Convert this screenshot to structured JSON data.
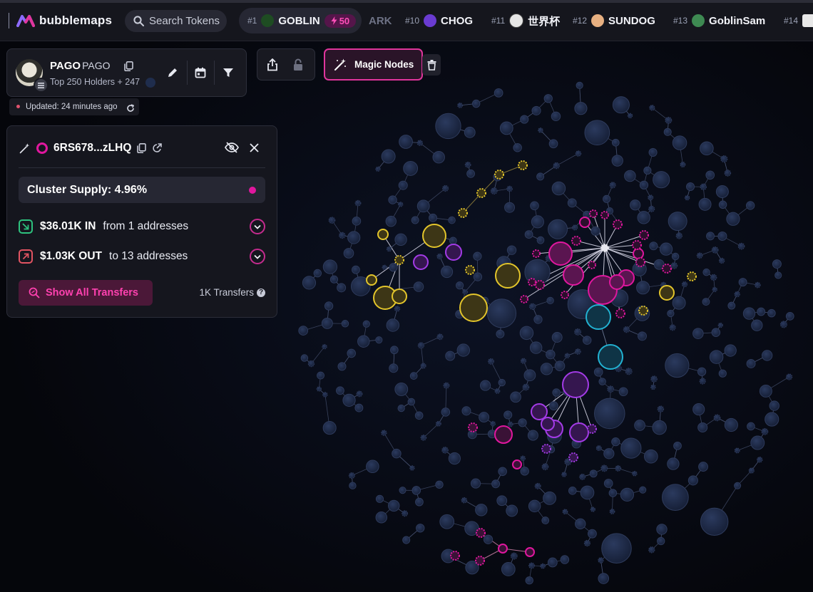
{
  "app": {
    "logo_text": "bubblemaps"
  },
  "search": {
    "placeholder": "Search Tokens"
  },
  "ticker": [
    {
      "rank": "#1",
      "name": "GOBLIN",
      "badge": "50",
      "cover": "#1e4c22"
    },
    {
      "rank": "",
      "name": "ARK"
    },
    {
      "rank": "#10",
      "name": "CHOG",
      "cover": "#6a3bd1"
    },
    {
      "rank": "#11",
      "name": "世界杯",
      "cover": "#e6e6e6"
    },
    {
      "rank": "#12",
      "name": "SUNDOG",
      "cover": "#e7b081"
    },
    {
      "rank": "#13",
      "name": "GoblinSam",
      "cover": "#3e8a52"
    },
    {
      "rank": "#14",
      "name": ""
    }
  ],
  "token": {
    "name": "PAGO",
    "symbol": "PAGO",
    "subtitle": "Top 250 Holders + 247",
    "updated": "Updated: 24 minutes ago"
  },
  "toolbar": {
    "magic_label": "Magic Nodes"
  },
  "cluster": {
    "address": "6RS678...zLHQ",
    "supply_label": "Cluster Supply: 4.96%",
    "in_amount": "$36.01K IN",
    "in_text": "from 1 addresses",
    "out_amount": "$1.03K OUT",
    "out_text": "to 13 addresses",
    "show_label": "Show All Transfers",
    "transfers_label": "1K Transfers"
  },
  "colors": {
    "accent": "#e0179e",
    "yellow_cluster": "#e3c52b",
    "purple_cluster": "#a33be6",
    "cyan_cluster": "#22b2d2",
    "node": "#1b2640"
  },
  "icons": [
    "search-icon",
    "copy-icon",
    "pencil-icon",
    "calendar-icon",
    "filter-icon",
    "share-icon",
    "lock-icon",
    "magic-wand-icon",
    "trash-icon",
    "eye-off-icon",
    "close-icon",
    "refresh-icon",
    "arrow-in-icon",
    "arrow-out-icon",
    "chevron-down-icon",
    "help-icon"
  ]
}
